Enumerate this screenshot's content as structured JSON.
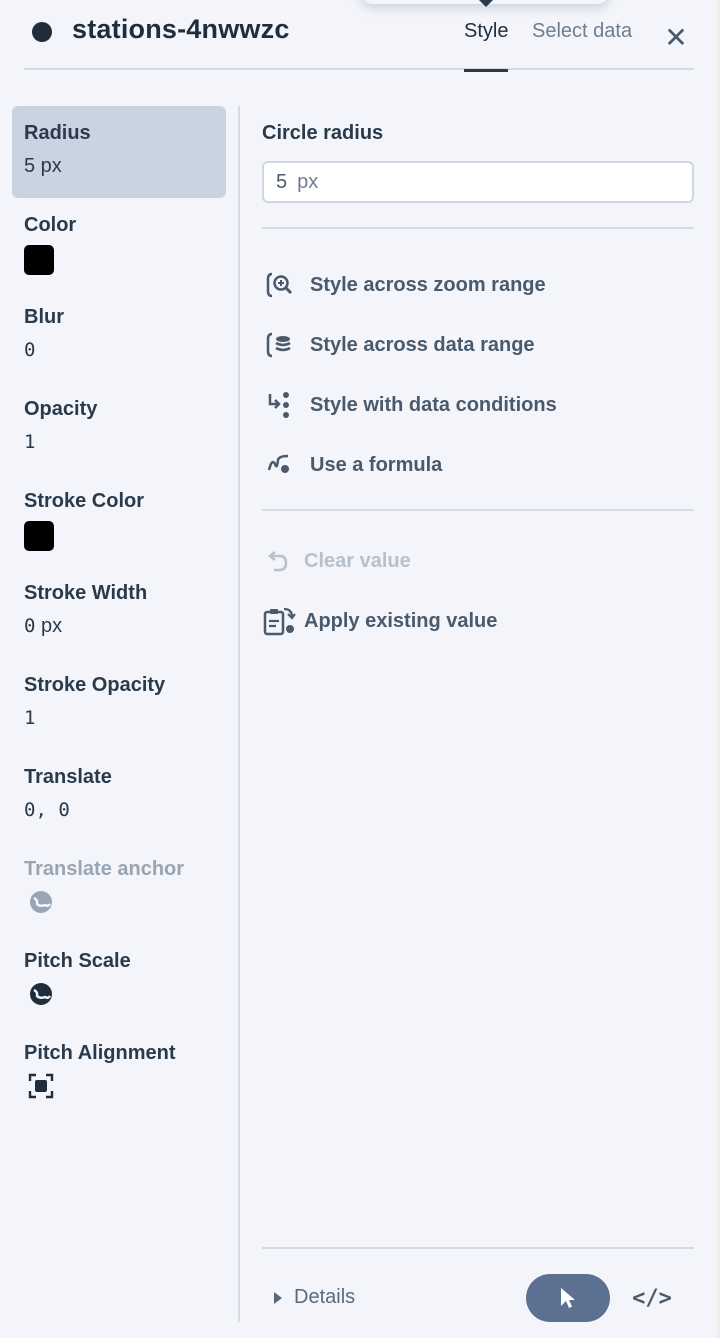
{
  "header": {
    "layer_name": "stations-4nwwzc",
    "tabs": [
      {
        "label": "Style",
        "active": true
      },
      {
        "label": "Select data",
        "active": false
      }
    ],
    "close_icon": "close-icon"
  },
  "properties": [
    {
      "label": "Radius",
      "value": "5 px",
      "active": true
    },
    {
      "label": "Color",
      "swatch": "#000000"
    },
    {
      "label": "Blur",
      "value": "0"
    },
    {
      "label": "Opacity",
      "value": "1"
    },
    {
      "label": "Stroke Color",
      "swatch": "#000000"
    },
    {
      "label": "Stroke Width",
      "value_num": "0",
      "value_unit": "px"
    },
    {
      "label": "Stroke Opacity",
      "value": "1"
    },
    {
      "label": "Translate",
      "value": "0, 0"
    },
    {
      "label": "Translate anchor",
      "icon": "globe-icon",
      "disabled": true
    },
    {
      "label": "Pitch Scale",
      "icon": "globe-icon"
    },
    {
      "label": "Pitch Alignment",
      "icon": "viewport-icon"
    }
  ],
  "editor": {
    "label": "Circle radius",
    "input_value": "5",
    "input_unit": "px",
    "options": [
      {
        "label": "Style across zoom range",
        "icon": "zoom-range-icon"
      },
      {
        "label": "Style across data range",
        "icon": "data-range-icon"
      },
      {
        "label": "Style with data conditions",
        "icon": "data-conditions-icon"
      },
      {
        "label": "Use a formula",
        "icon": "formula-icon"
      }
    ],
    "actions": [
      {
        "label": "Clear value",
        "icon": "undo-icon",
        "disabled": true
      },
      {
        "label": "Apply existing value",
        "icon": "clipboard-icon",
        "disabled": false
      }
    ]
  },
  "footer": {
    "details_label": "Details",
    "pointer_icon": "cursor-icon",
    "code_label": "</>"
  },
  "colors": {
    "accent": "#5c7191",
    "active_bg": "#c9d3e1",
    "text": "#2b3a4a"
  }
}
